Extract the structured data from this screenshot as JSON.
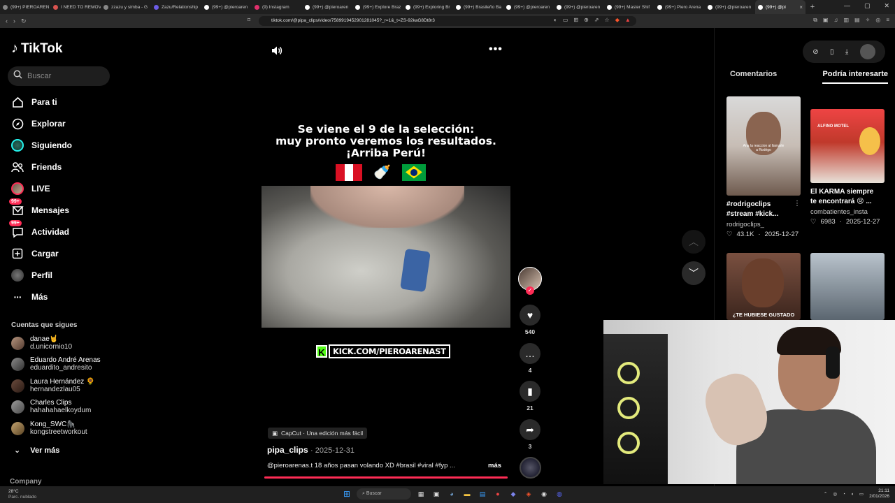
{
  "browser": {
    "tabs": [
      {
        "label": "(99+) PIEROAREN",
        "color": "#888"
      },
      {
        "label": "I NEED TO REMOV",
        "color": "#d9534f"
      },
      {
        "label": "zzazu y simba - G",
        "color": "#888"
      },
      {
        "label": "Zazu/Relationship",
        "color": "#6c5ce7"
      },
      {
        "label": "(99+) @pieroaren",
        "color": "#fff"
      },
      {
        "label": "(9) Instagram",
        "color": "#e1306c"
      },
      {
        "label": "(99+) @pieroaren",
        "color": "#fff"
      },
      {
        "label": "(99+) Explore Braz",
        "color": "#fff"
      },
      {
        "label": "(99+) Exploring Br",
        "color": "#fff"
      },
      {
        "label": "(99+) Brasileño Ba",
        "color": "#fff"
      },
      {
        "label": "(99+) @pieroaren",
        "color": "#fff"
      },
      {
        "label": "(99+) @pieroaren",
        "color": "#fff"
      },
      {
        "label": "(99+) Master Shif",
        "color": "#fff"
      },
      {
        "label": "(99+) Piero Arena",
        "color": "#fff"
      },
      {
        "label": "(99+) @pieroaren",
        "color": "#fff"
      },
      {
        "label": "(99+) @pi",
        "color": "#fff",
        "active": true
      }
    ],
    "url": "tiktok.com/@pipa_clips/video/7589919452901281045?_r=1&_t=ZS-92kaG8Dt8r3",
    "window_controls": [
      "—",
      "▢",
      "✕"
    ]
  },
  "sidebar": {
    "brand": "TikTok",
    "search_placeholder": "Buscar",
    "nav": [
      {
        "label": "Para ti",
        "icon": "home-icon"
      },
      {
        "label": "Explorar",
        "icon": "compass-icon"
      },
      {
        "label": "Siguiendo",
        "icon": "following-avatar-icon"
      },
      {
        "label": "Friends",
        "icon": "friends-icon"
      },
      {
        "label": "LIVE",
        "icon": "live-avatar-icon"
      },
      {
        "label": "Mensajes",
        "icon": "messages-icon",
        "badge": "99+"
      },
      {
        "label": "Actividad",
        "icon": "activity-icon",
        "badge": "99+"
      },
      {
        "label": "Cargar",
        "icon": "upload-icon"
      },
      {
        "label": "Perfil",
        "icon": "profile-avatar-icon"
      },
      {
        "label": "Más",
        "icon": "more-dots-icon"
      }
    ],
    "following_title": "Cuentas que sigues",
    "following": [
      {
        "name": "danae🤘",
        "handle": "d.unicornio10"
      },
      {
        "name": "Eduardo André Arenas",
        "handle": "eduardito_andresito"
      },
      {
        "name": "Laura Hernández 🌻",
        "handle": "hernandezlau05"
      },
      {
        "name": "Charles Clips",
        "handle": "hahahahaelkoydum"
      },
      {
        "name": "Kong_SWC🦍",
        "handle": "kongstreetworkout"
      }
    ],
    "see_more": "Ver más",
    "company": "Company"
  },
  "video": {
    "overlay_lines": [
      "Se viene el 9 de la selección:",
      "muy pronto veremos los resultados.",
      "¡Arriba Perú!"
    ],
    "kick_text": "KICK.COM/PIEROARENAST",
    "kick_letter": "K",
    "capcut": "CapCut · Una edición más fácil",
    "author": "pipa_clips",
    "date": "· 2025-12-31",
    "description": "@pieroarenas.t 18 años pasan volando XD #brasil #viral #fyp ...",
    "more": "más",
    "progress": 1.0
  },
  "actions": {
    "likes": "540",
    "comments": "4",
    "saves": "21",
    "shares": "3"
  },
  "right_panel": {
    "tabs": [
      "Comentarios",
      "Podría interesarte"
    ],
    "active_tab": 1,
    "cards": [
      {
        "title": "#rodrigoclips #stream #kick...",
        "user": "rodrigoclips_",
        "likes": "43.1K",
        "date": "2025-12-27"
      },
      {
        "title": "El KARMA siempre te encontrará 😢 ...",
        "user": "combatientes_insta",
        "likes": "6983",
        "date": "2025-12-27"
      },
      {
        "title": "",
        "user": "",
        "likes": "",
        "date": "",
        "thumb_text": "¿TE HUBIESE GUSTADO"
      },
      {
        "title": "",
        "user": "",
        "likes": "",
        "date": ""
      }
    ],
    "card0_thumb_text": "Ana la reaccion al llamarle a Rodrigo",
    "card1_thumb_text": "ALFINO MOTEL"
  },
  "taskbar": {
    "weather_temp": "28°C",
    "weather_desc": "Parc. nublado",
    "search": "Buscar",
    "time": "21:11",
    "date": "2/01/2026"
  },
  "colors": {
    "accent": "#fe2c55",
    "kick_green": "#53fc18"
  }
}
